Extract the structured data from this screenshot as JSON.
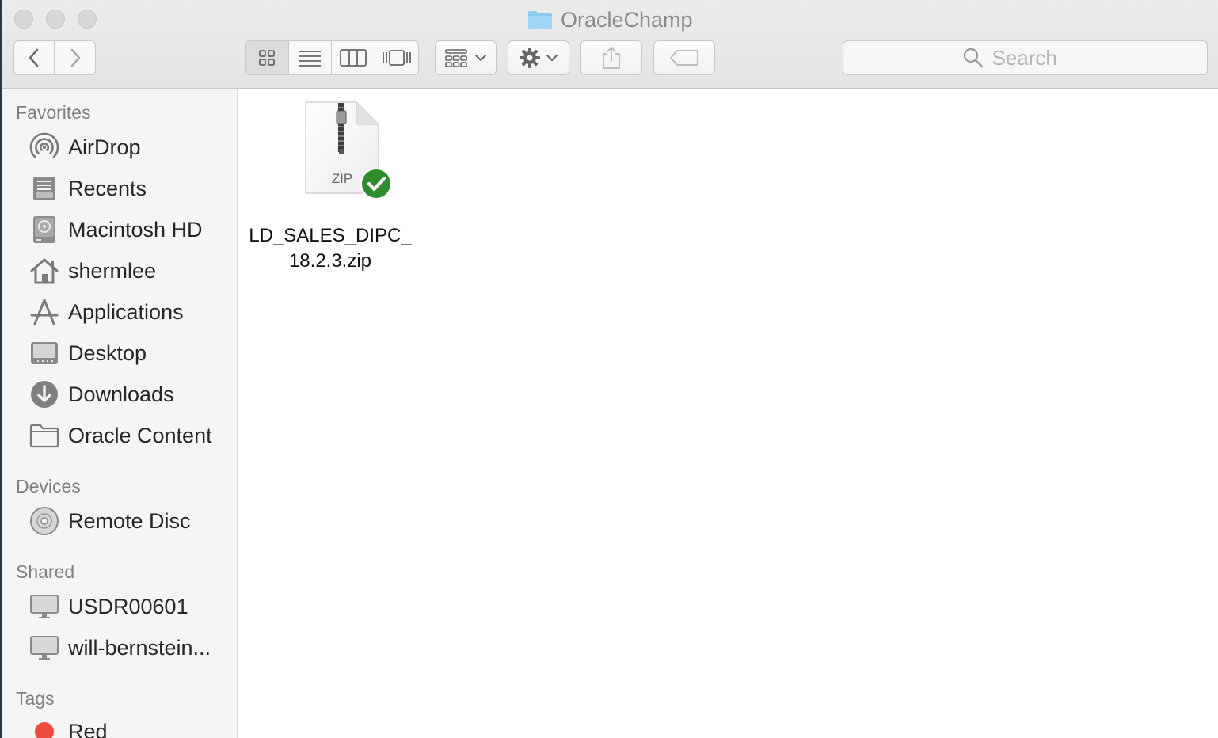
{
  "window": {
    "title": "OracleChamp"
  },
  "toolbar": {
    "view_modes": [
      "icon-view",
      "list-view",
      "column-view",
      "gallery-view"
    ],
    "active_view": "icon-view"
  },
  "search": {
    "placeholder": "Search",
    "value": ""
  },
  "sidebar": {
    "favorites_header": "Favorites",
    "favorites": [
      {
        "label": "AirDrop",
        "icon": "airdrop-icon"
      },
      {
        "label": "Recents",
        "icon": "recents-icon"
      },
      {
        "label": "Macintosh HD",
        "icon": "hard-drive-icon"
      },
      {
        "label": "shermlee",
        "icon": "home-icon"
      },
      {
        "label": "Applications",
        "icon": "applications-icon"
      },
      {
        "label": "Desktop",
        "icon": "desktop-icon"
      },
      {
        "label": "Downloads",
        "icon": "downloads-icon"
      },
      {
        "label": "Oracle Content",
        "icon": "folder-icon"
      }
    ],
    "devices_header": "Devices",
    "devices": [
      {
        "label": "Remote Disc",
        "icon": "disc-icon"
      }
    ],
    "shared_header": "Shared",
    "shared": [
      {
        "label": "USDR00601",
        "icon": "computer-icon"
      },
      {
        "label": "will-bernstein...",
        "icon": "computer-icon"
      }
    ],
    "tags_header": "Tags",
    "tags": [
      {
        "label": "Red",
        "color": "#ee4b40"
      }
    ]
  },
  "files": [
    {
      "name": "LD_SALES_DIPC_18.2.3.zip",
      "type_label": "ZIP",
      "status": "synced",
      "status_color": "#2e8b2e"
    }
  ]
}
